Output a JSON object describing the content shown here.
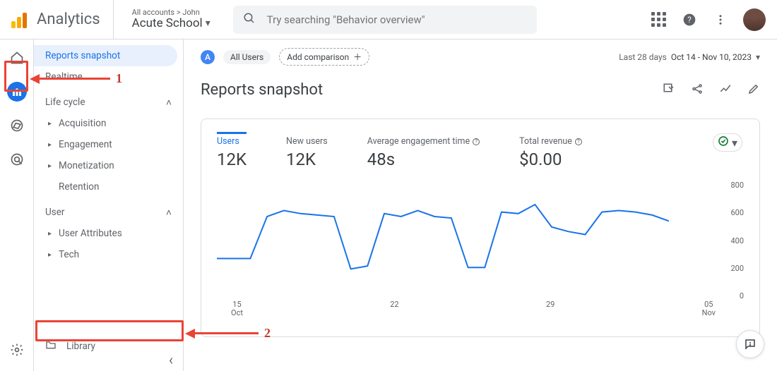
{
  "header": {
    "brand": "Analytics",
    "breadcrumb": "All accounts > John",
    "property": "Acute School",
    "search_placeholder": "Try searching \"Behavior overview\""
  },
  "sidebar": {
    "snapshot": "Reports snapshot",
    "realtime": "Realtime",
    "lifecycle": {
      "title": "Life cycle",
      "items": [
        "Acquisition",
        "Engagement",
        "Monetization",
        "Retention"
      ]
    },
    "user": {
      "title": "User",
      "items": [
        "User Attributes",
        "Tech"
      ]
    },
    "library": "Library"
  },
  "segments": {
    "badge": "A",
    "all_users": "All Users",
    "add_comparison": "Add comparison"
  },
  "date_range": {
    "preset": "Last 28 days",
    "range": "Oct 14 - Nov 10, 2023"
  },
  "page_title": "Reports snapshot",
  "metrics": [
    {
      "label": "Users",
      "value": "12K"
    },
    {
      "label": "New users",
      "value": "12K"
    },
    {
      "label": "Average engagement time",
      "value": "48s"
    },
    {
      "label": "Total revenue",
      "value": "$0.00"
    }
  ],
  "chart_data": {
    "type": "line",
    "xlabel": "",
    "ylabel": "",
    "ylim": [
      0,
      800
    ],
    "y_ticks": [
      0,
      200,
      400,
      600,
      800
    ],
    "x_ticks": [
      {
        "major": "15",
        "minor": "Oct"
      },
      {
        "major": "22",
        "minor": ""
      },
      {
        "major": "29",
        "minor": ""
      },
      {
        "major": "05",
        "minor": "Nov"
      }
    ],
    "series": [
      {
        "name": "Users",
        "color": "#1a73e8",
        "values": [
          280,
          280,
          280,
          560,
          600,
          580,
          570,
          560,
          210,
          230,
          580,
          560,
          600,
          560,
          550,
          220,
          220,
          590,
          580,
          640,
          490,
          460,
          440,
          590,
          600,
          590,
          570,
          530
        ]
      }
    ]
  },
  "annotations": {
    "label1": "1",
    "label2": "2"
  }
}
